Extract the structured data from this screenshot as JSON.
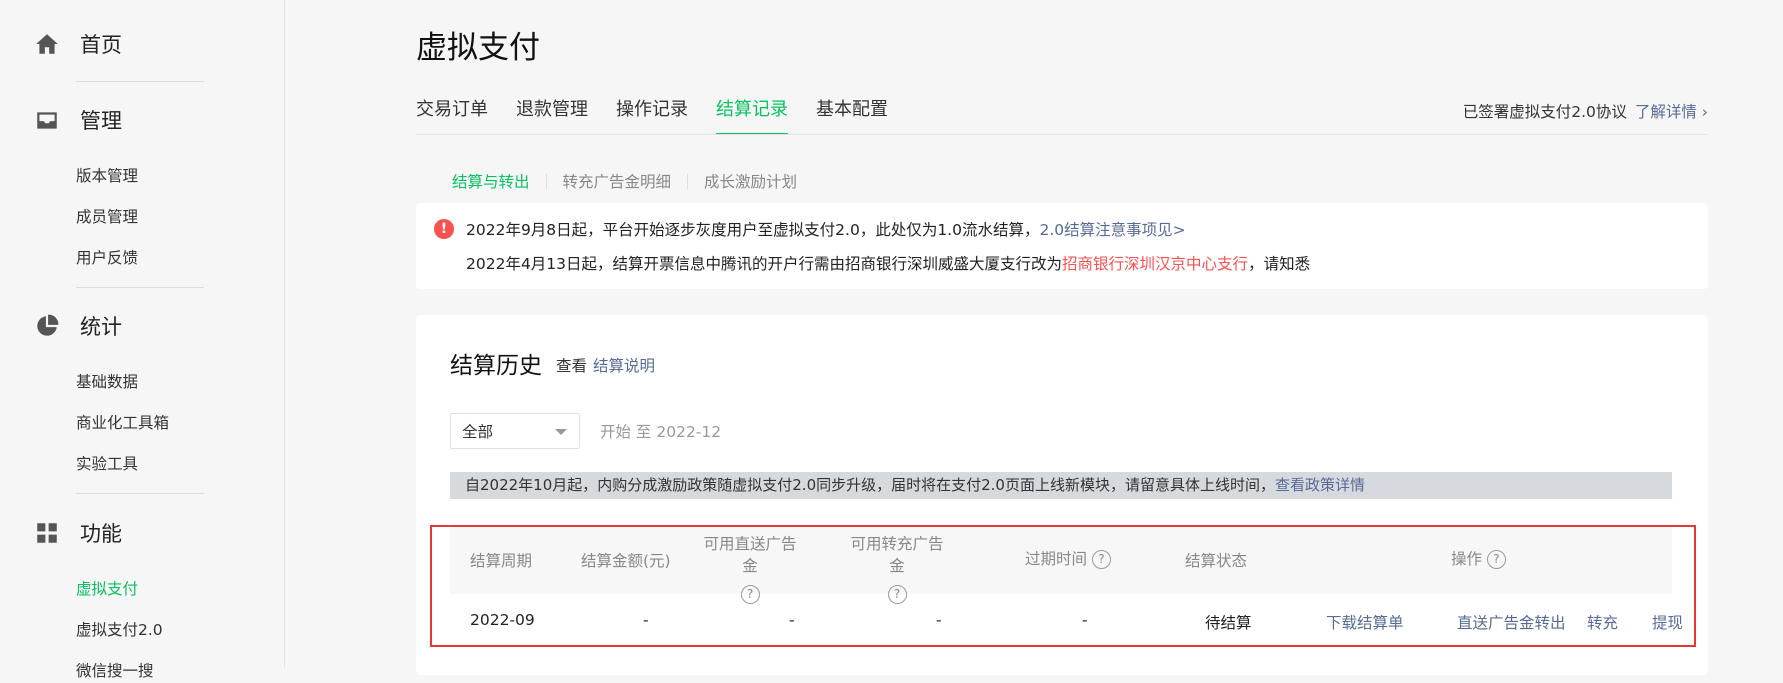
{
  "sidebar": {
    "groups": [
      {
        "label": "首页",
        "icon": "home-icon"
      },
      {
        "label": "管理",
        "icon": "inbox-icon",
        "items": [
          "版本管理",
          "成员管理",
          "用户反馈"
        ]
      },
      {
        "label": "统计",
        "icon": "pie-chart-icon",
        "items": [
          "基础数据",
          "商业化工具箱",
          "实验工具"
        ]
      },
      {
        "label": "功能",
        "icon": "grid-icon",
        "items": [
          "虚拟支付",
          "虚拟支付2.0",
          "微信搜一搜"
        ]
      }
    ],
    "active_item": "虚拟支付"
  },
  "page": {
    "title": "虚拟支付",
    "tabs": [
      "交易订单",
      "退款管理",
      "操作记录",
      "结算记录",
      "基本配置"
    ],
    "active_tab": "结算记录",
    "agreement_text": "已签署虚拟支付2.0协议",
    "agreement_link": "了解详情 ›"
  },
  "subtabs": [
    "结算与转出",
    "转充广告金明细",
    "成长激励计划"
  ],
  "notice": {
    "line1_text": "2022年9月8日起，平台开始逐步灰度用户至虚拟支付2.0，此处仅为1.0流水结算，",
    "line1_link": "2.0结算注意事项见>",
    "line2_pre": "2022年4月13日起，结算开票信息中腾讯的开户行需由招商银行深圳威盛大厦支行改为",
    "line2_red": "招商银行深圳汉京中心支行",
    "line2_post": "，请知悉"
  },
  "history": {
    "title": "结算历史",
    "view_label": "查看",
    "view_link": "结算说明",
    "filter_value": "全部",
    "range_text": "开始 至 2022-12",
    "banner_text": "自2022年10月起，内购分成激励政策随虚拟支付2.0同步升级，届时将在支付2.0页面上线新模块，请留意具体上线时间，",
    "banner_link": "查看政策详情",
    "columns": {
      "period": "结算周期",
      "amount": "结算金额(元)",
      "direct": "可用直送广告金",
      "transfer": "可用转充广告金",
      "expire": "过期时间",
      "status": "结算状态",
      "ops": "操作"
    },
    "row": {
      "period": "2022-09",
      "amount": "-",
      "direct": "-",
      "transfer": "-",
      "expire": "-",
      "status": "待结算",
      "ops": [
        "下载结算单",
        "直送广告金转出",
        "转充",
        "提现"
      ]
    }
  }
}
